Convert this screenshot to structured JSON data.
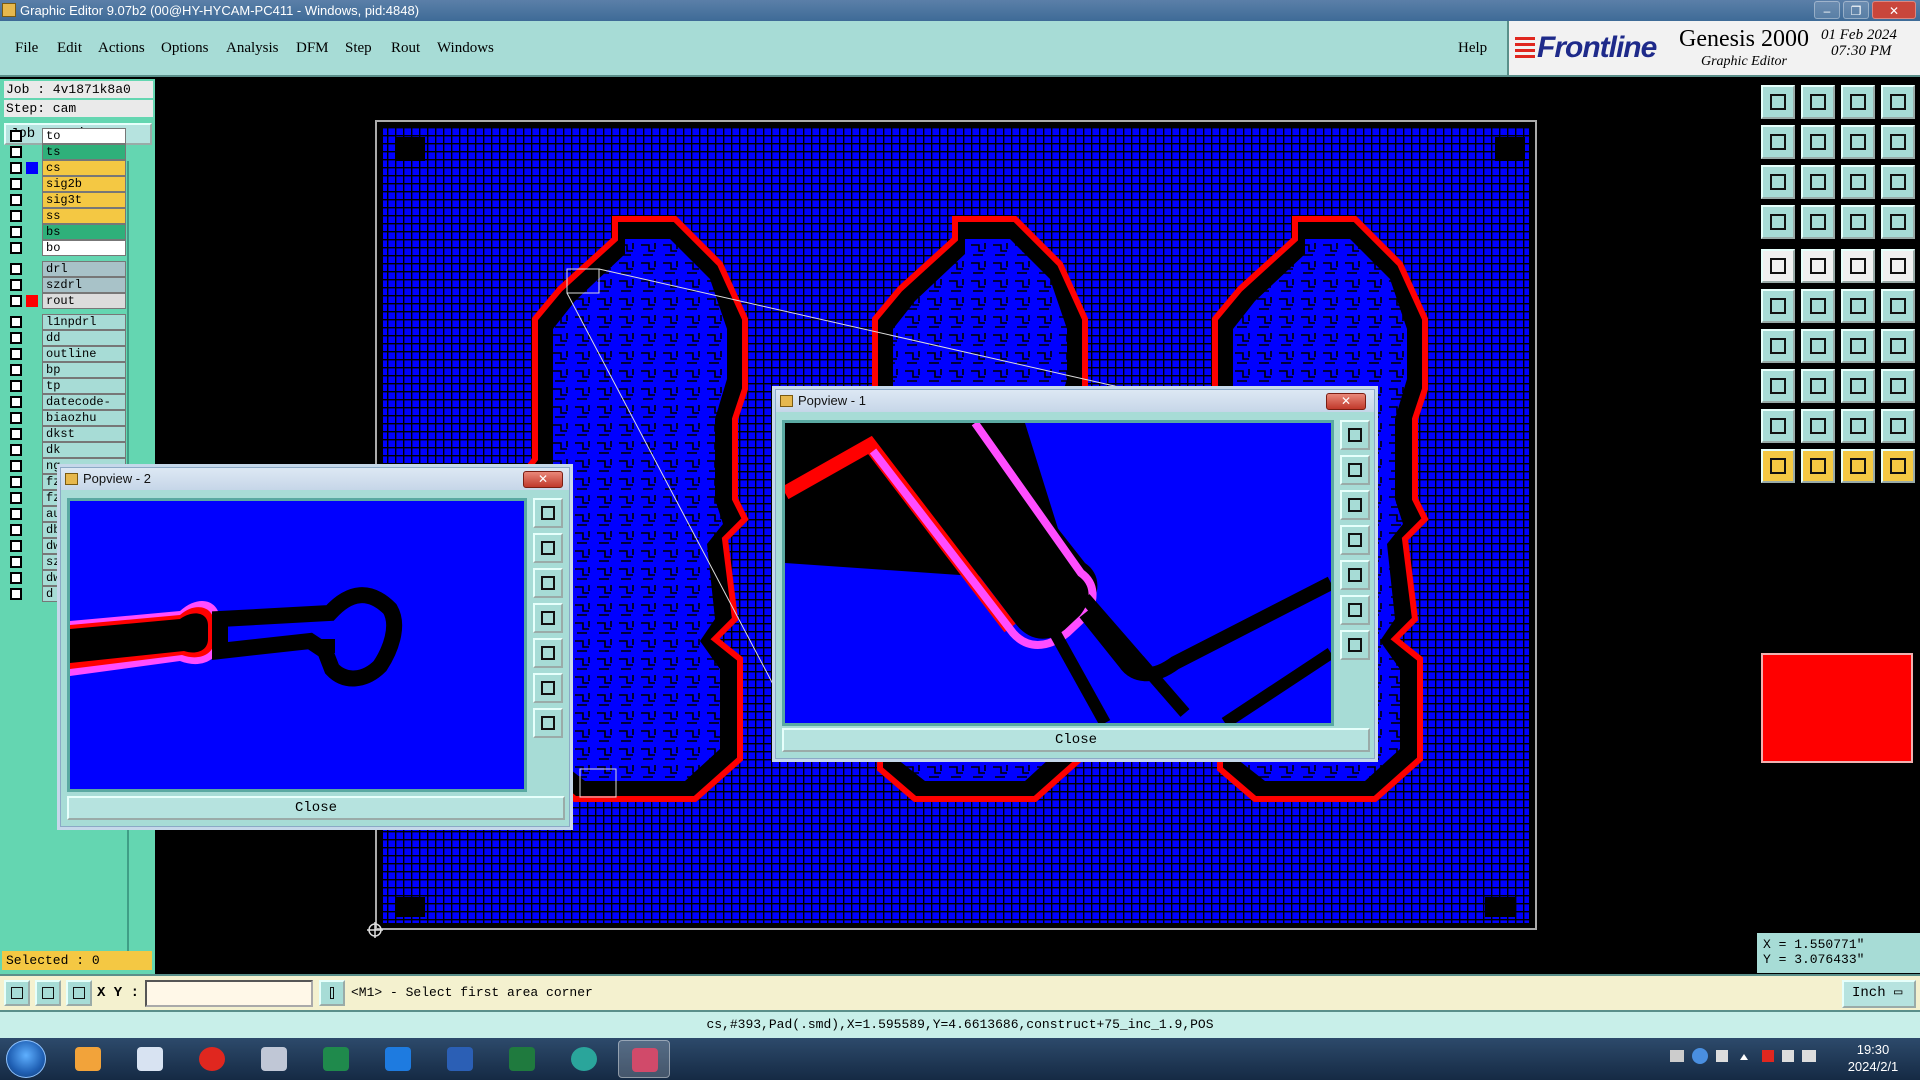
{
  "window": {
    "title": "Graphic Editor 9.07b2 (00@HY-HYCAM-PC411 - Windows, pid:4848)",
    "controls": [
      "–",
      "❐",
      "✕"
    ]
  },
  "menu": {
    "items": [
      {
        "label": "File"
      },
      {
        "label": "Edit"
      },
      {
        "label": "Actions"
      },
      {
        "label": "Options"
      },
      {
        "label": "Analysis"
      },
      {
        "label": "DFM"
      },
      {
        "label": "Step"
      },
      {
        "label": "Rout"
      },
      {
        "label": "Windows"
      }
    ],
    "help": "Help"
  },
  "brand": {
    "logo": "Frontline",
    "product": "Genesis 2000",
    "subtitle": "Graphic Editor",
    "date": "01 Feb 2024",
    "time": "07:30 PM"
  },
  "job": {
    "job_line": "Job : 4v1871k8a0",
    "step_line": "Step: cam",
    "matrix_button": "Job Matrix ..."
  },
  "layers": [
    {
      "name": "to",
      "color": "#ffffff",
      "swatch": ""
    },
    {
      "name": "ts",
      "color": "#2fb07a",
      "swatch": ""
    },
    {
      "name": "cs",
      "color": "#f4c843",
      "swatch": "#0000ff",
      "active": true
    },
    {
      "name": "sig2b",
      "color": "#f4c843",
      "swatch": ""
    },
    {
      "name": "sig3t",
      "color": "#f4c843",
      "swatch": ""
    },
    {
      "name": "ss",
      "color": "#f4c843",
      "swatch": ""
    },
    {
      "name": "bs",
      "color": "#2fb07a",
      "swatch": ""
    },
    {
      "name": "bo",
      "color": "#ffffff",
      "swatch": ""
    },
    {
      "name": "drl",
      "color": "#a8c2c8",
      "swatch": ""
    },
    {
      "name": "szdrl",
      "color": "#a8c2c8",
      "swatch": ""
    },
    {
      "name": "rout",
      "color": "#dcdcdc",
      "swatch": "#ff0000"
    },
    {
      "name": "l1npdrl",
      "color": "#a7dcd6",
      "swatch": ""
    },
    {
      "name": "dd",
      "color": "#a7dcd6",
      "swatch": ""
    },
    {
      "name": "outline",
      "color": "#a7dcd6",
      "swatch": ""
    },
    {
      "name": "bp",
      "color": "#a7dcd6",
      "swatch": ""
    },
    {
      "name": "tp",
      "color": "#a7dcd6",
      "swatch": ""
    },
    {
      "name": "datecode-bo",
      "color": "#a7dcd6",
      "swatch": ""
    },
    {
      "name": "biaozhu",
      "color": "#a7dcd6",
      "swatch": ""
    },
    {
      "name": "dkst",
      "color": "#a7dcd6",
      "swatch": ""
    },
    {
      "name": "dk",
      "color": "#a7dcd6",
      "swatch": ""
    },
    {
      "name": "ng",
      "color": "#a7dcd6",
      "swatch": ""
    },
    {
      "name": "fz",
      "color": "#a7dcd6",
      "swatch": ""
    },
    {
      "name": "fz",
      "color": "#a7dcd6",
      "swatch": ""
    },
    {
      "name": "au",
      "color": "#a7dcd6",
      "swatch": ""
    },
    {
      "name": "db",
      "color": "#a7dcd6",
      "swatch": ""
    },
    {
      "name": "dw",
      "color": "#a7dcd6",
      "swatch": ""
    },
    {
      "name": "sz",
      "color": "#a7dcd6",
      "swatch": ""
    },
    {
      "name": "dw",
      "color": "#a7dcd6",
      "swatch": ""
    },
    {
      "name": "d",
      "color": "#a7dcd6",
      "swatch": ""
    }
  ],
  "selected": "Selected : 0",
  "popup2": {
    "title": "Popview - 2",
    "close_label": "Close"
  },
  "popup1": {
    "title": "Popview - 1",
    "close_label": "Close"
  },
  "coords": {
    "x": "X = 1.550771\"",
    "y": "Y = 3.076433\""
  },
  "command": {
    "xy_label": "X Y :",
    "xy_value": "",
    "prompt": "<M1> - Select first area corner",
    "unit": "Inch"
  },
  "status": "cs,#393,Pad(.smd),X=1.595589,Y=4.6613686,construct+75_inc_1.9,POS",
  "clock": {
    "time": "19:30",
    "date": "2024/2/1"
  },
  "colors": {
    "accent": "#a7dcd6",
    "board": "#0000ff",
    "rout": "#ff0000",
    "highlight": "#ff4dff"
  }
}
